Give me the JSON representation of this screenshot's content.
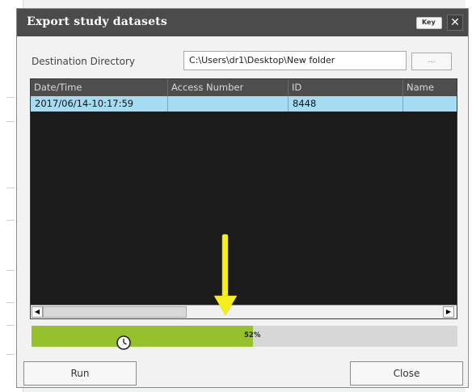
{
  "dialog": {
    "title": "Export study datasets",
    "key_label": "Key",
    "close_glyph": "✕"
  },
  "destination": {
    "label": "Destination Directory",
    "value": "C:\\Users\\dr1\\Desktop\\New folder",
    "browse_label": "..."
  },
  "table": {
    "columns": [
      "Date/Time",
      "Access Number",
      "ID",
      "Name"
    ],
    "rows": [
      [
        "2017/06/14-10:17:59",
        "",
        "8448",
        ""
      ]
    ]
  },
  "scrollbar": {
    "left_arrow": "◀",
    "right_arrow": "▶"
  },
  "progress": {
    "percent": 52,
    "label": "52%",
    "fill_color": "#96c12d"
  },
  "buttons": {
    "run": "Run",
    "close": "Close"
  },
  "annotation": {
    "arrow_color": "#f5ef1d",
    "icon": "arrow-down-icon"
  },
  "cursor_icon": "busy-clock-cursor-icon"
}
